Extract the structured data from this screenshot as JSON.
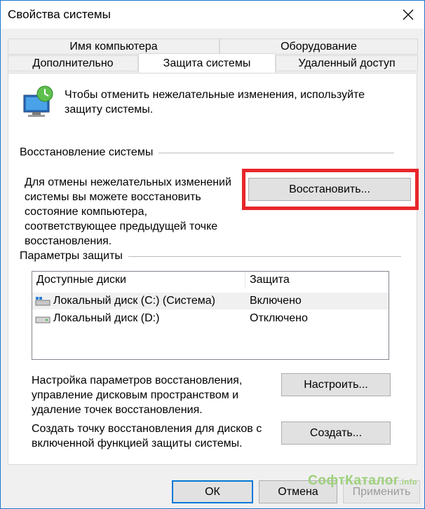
{
  "window": {
    "title": "Свойства системы"
  },
  "tabs": {
    "row1": [
      "Имя компьютера",
      "Оборудование"
    ],
    "row2": [
      "Дополнительно",
      "Защита системы",
      "Удаленный доступ"
    ],
    "active": "Защита системы"
  },
  "intro": {
    "text": "Чтобы отменить нежелательные изменения, используйте защиту системы."
  },
  "restore_group": {
    "label": "Восстановление системы",
    "description": "Для отмены нежелательных изменений системы вы можете восстановить состояние компьютера, соответствующее предыдущей точке восстановления.",
    "button": "Восстановить..."
  },
  "protection_group": {
    "label": "Параметры защиты",
    "columns": [
      "Доступные диски",
      "Защита"
    ],
    "drives": [
      {
        "name": "Локальный диск (C:) (Система)",
        "status": "Включено",
        "icon": "system-drive-icon"
      },
      {
        "name": "Локальный диск (D:)",
        "status": "Отключено",
        "icon": "drive-icon"
      }
    ],
    "configure_text": "Настройка параметров восстановления, управление дисковым пространством и удаление точек восстановления.",
    "configure_button": "Настроить...",
    "create_text": "Создать точку восстановления для дисков с включенной функцией защиты системы.",
    "create_button": "Создать..."
  },
  "footer": {
    "ok": "ОК",
    "cancel": "Отмена",
    "apply": "Применить"
  },
  "watermark": {
    "main": "СофтКаталог",
    "suffix": ".info"
  },
  "colors": {
    "highlight": "#e8262a",
    "window_border": "#1e78d2",
    "watermark": "#9cd07a"
  }
}
